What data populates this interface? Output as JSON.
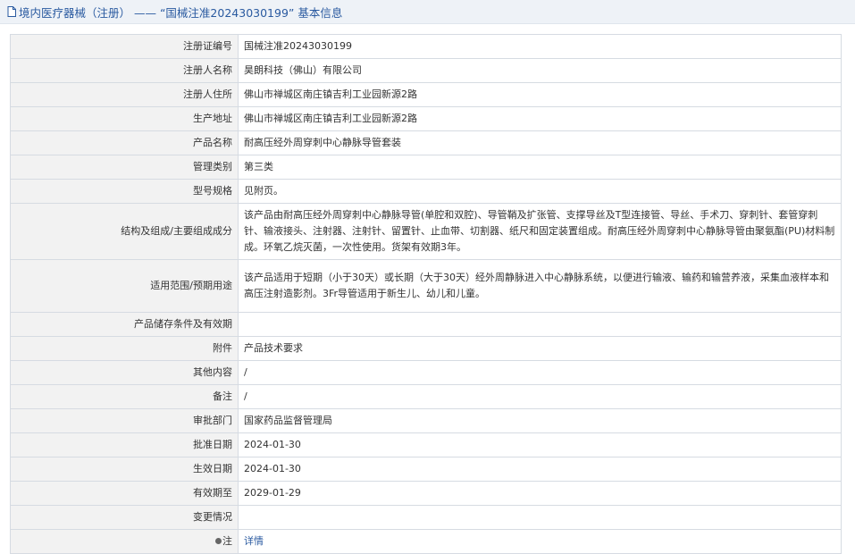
{
  "header": {
    "title": "境内医疗器械（注册） —— “国械注准20243030199” 基本信息"
  },
  "rows": [
    {
      "label": "注册证编号",
      "value": "国械注准20243030199"
    },
    {
      "label": "注册人名称",
      "value": "昊朗科技（佛山）有限公司"
    },
    {
      "label": "注册人住所",
      "value": "佛山市禅城区南庄镇吉利工业园新源2路"
    },
    {
      "label": "生产地址",
      "value": "佛山市禅城区南庄镇吉利工业园新源2路"
    },
    {
      "label": "产品名称",
      "value": "耐高压经外周穿刺中心静脉导管套装"
    },
    {
      "label": "管理类别",
      "value": "第三类"
    },
    {
      "label": "型号规格",
      "value": "见附页。"
    },
    {
      "label": "结构及组成/主要组成成分",
      "value": "该产品由耐高压经外周穿刺中心静脉导管(单腔和双腔)、导管鞘及扩张管、支撑导丝及T型连接管、导丝、手术刀、穿刺针、套管穿刺针、输液接头、注射器、注射针、留置针、止血带、切割器、纸尺和固定装置组成。耐高压经外周穿刺中心静脉导管由聚氨酯(PU)材料制成。环氧乙烷灭菌，一次性使用。货架有效期3年。"
    },
    {
      "label": "适用范围/预期用途",
      "value": "该产品适用于短期（小于30天）或长期（大于30天）经外周静脉进入中心静脉系统，以便进行输液、输药和输营养液，采集血液样本和高压注射造影剂。3Fr导管适用于新生儿、幼儿和儿童。"
    },
    {
      "label": "产品储存条件及有效期",
      "value": ""
    },
    {
      "label": "附件",
      "value": "产品技术要求"
    },
    {
      "label": "其他内容",
      "value": "/"
    },
    {
      "label": "备注",
      "value": "/"
    },
    {
      "label": "审批部门",
      "value": "国家药品监督管理局"
    },
    {
      "label": "批准日期",
      "value": "2024-01-30"
    },
    {
      "label": "生效日期",
      "value": "2024-01-30"
    },
    {
      "label": "有效期至",
      "value": "2029-01-29"
    },
    {
      "label": "变更情况",
      "value": ""
    },
    {
      "label": "注",
      "value": "详情"
    }
  ]
}
